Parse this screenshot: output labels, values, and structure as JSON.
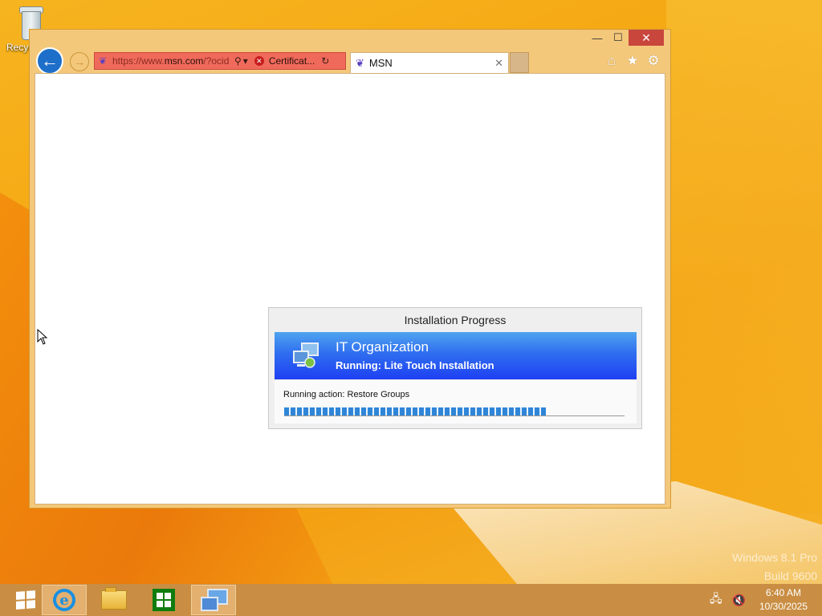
{
  "desktop": {
    "recycle_bin_label": "Recyc",
    "watermark_line1": "Windows 8.1 Pro",
    "watermark_line2": "Build 9600"
  },
  "browser": {
    "window_controls": {
      "minimize": "—",
      "maximize": "☐",
      "close": "✕"
    },
    "address": {
      "url_prefix": "https://www.",
      "url_domain": "msn.com",
      "url_suffix": "/?ocid",
      "certificate_label": "Certificat..."
    },
    "tab": {
      "title": "MSN"
    },
    "toolbar_icons": [
      "home-icon",
      "favorites-star-icon",
      "settings-gear-icon"
    ]
  },
  "dialog": {
    "title": "Installation Progress",
    "banner_title": "IT Organization",
    "banner_subtitle": "Running: Lite Touch Installation",
    "action_text": "Running action: Restore Groups",
    "progress_fraction": 0.77
  },
  "taskbar": {
    "items": [
      "start",
      "internet-explorer",
      "file-explorer",
      "store",
      "deployment-setup"
    ],
    "active": [
      "internet-explorer",
      "deployment-setup"
    ],
    "clock_time": "6:40 AM",
    "clock_date": "10/30/2025"
  },
  "colors": {
    "accent_blue": "#2f6ef0",
    "close_red": "#c9463d",
    "taskbar": "#c98e43"
  }
}
